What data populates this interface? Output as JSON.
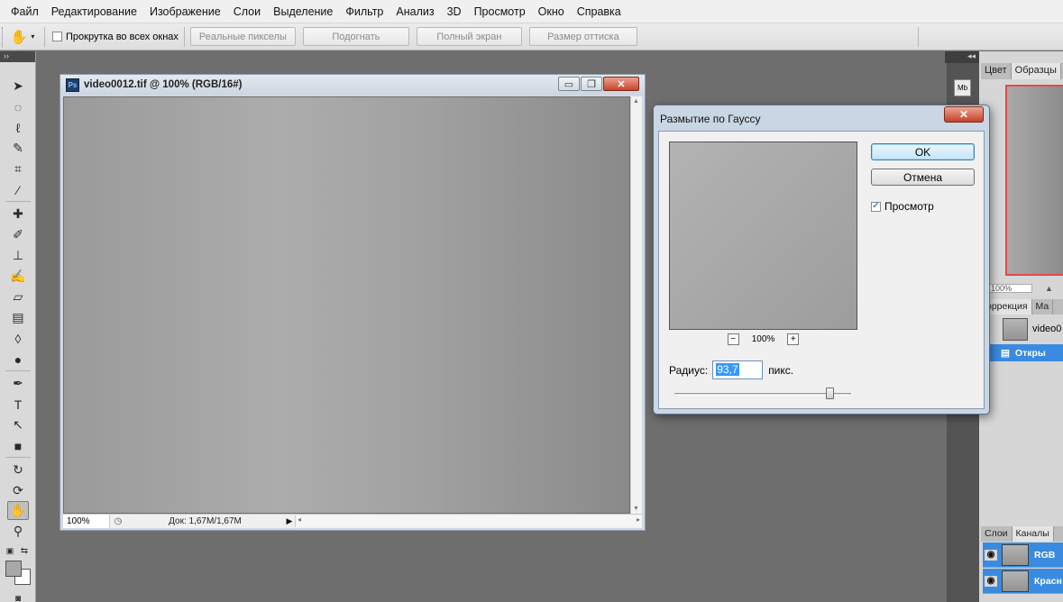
{
  "menubar": {
    "items": [
      "Файл",
      "Редактирование",
      "Изображение",
      "Слои",
      "Выделение",
      "Фильтр",
      "Анализ",
      "3D",
      "Просмотр",
      "Окно",
      "Справка"
    ]
  },
  "options": {
    "tool_icon": "hand-icon",
    "scroll_all_label": "Прокрутка во всех окнах",
    "scroll_all_checked": false,
    "buttons": [
      "Реальные пикселы",
      "Подогнать",
      "Полный экран",
      "Размер оттиска"
    ]
  },
  "tools": {
    "panel_header": "››",
    "icons": [
      "move-icon",
      "ellipse-marquee-icon",
      "lasso-icon",
      "quick-selection-icon",
      "crop-icon",
      "eyedropper-icon",
      "healing-brush-icon",
      "brush-icon",
      "clone-stamp-icon",
      "history-brush-icon",
      "eraser-icon",
      "gradient-icon",
      "blur-icon",
      "dodge-icon",
      "pen-icon",
      "type-icon",
      "path-selection-icon",
      "rectangle-icon",
      "3d-rotate-icon",
      "3d-orbit-icon",
      "hand-icon",
      "zoom-icon"
    ],
    "active_tool": "hand-icon",
    "foreground_color": "#a8a8a8",
    "background_color": "#ffffff"
  },
  "document": {
    "title": "video0012.tif @ 100% (RGB/16#)",
    "app_badge": "Ps",
    "zoom": "100%",
    "doc_size": "Док: 1,67M/1,67M"
  },
  "dialog": {
    "title": "Размытие по Гауссу",
    "ok_label": "OK",
    "cancel_label": "Отмена",
    "preview_label": "Просмотр",
    "preview_checked": true,
    "preview_zoom": "100%",
    "zoom_out": "−",
    "zoom_in": "+",
    "radius_label": "Радиус:",
    "radius_value": "93,7",
    "radius_unit": "пикс.",
    "slider_fraction": 0.88
  },
  "right_panels": {
    "collapse_glyph": "◂◂",
    "mini_icon_label": "Mb",
    "top_tabs": [
      "Цвет",
      "Образцы"
    ],
    "navigator_zoom": "100%",
    "mid_tabs": [
      "оррекция",
      "Ма"
    ],
    "history_item": "video0",
    "history_selected": "Откры",
    "bottom_tabs": [
      "Слои",
      "Каналы"
    ],
    "channels": [
      "RGB",
      "Красн"
    ]
  }
}
